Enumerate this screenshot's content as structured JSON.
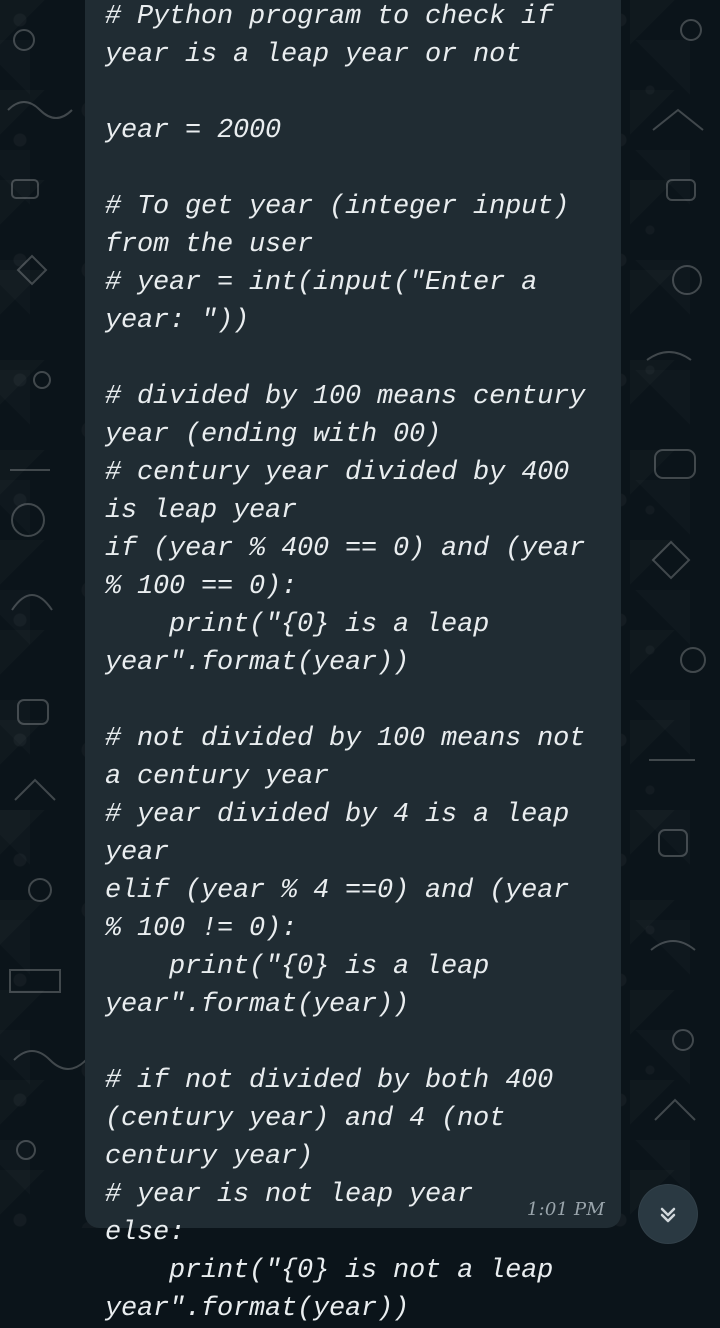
{
  "chat": {
    "message": {
      "text": "# Python program to check if year is a leap year or not\n\nyear = 2000\n\n# To get year (integer input) from the user\n# year = int(input(\"Enter a year: \"))\n\n# divided by 100 means century year (ending with 00)\n# century year divided by 400 is leap year\nif (year % 400 == 0) and (year % 100 == 0):\n    print(\"{0} is a leap year\".format(year))\n\n# not divided by 100 means not a century year\n# year divided by 4 is a leap year\nelif (year % 4 ==0) and (year % 100 != 0):\n    print(\"{0} is a leap year\".format(year))\n\n# if not divided by both 400 (century year) and 4 (not century year)\n# year is not leap year\nelse:\n    print(\"{0} is not a leap year\".format(year))",
      "time": "1:01 PM"
    },
    "controls": {
      "scroll_icon": "double-chevron-down-icon"
    }
  }
}
